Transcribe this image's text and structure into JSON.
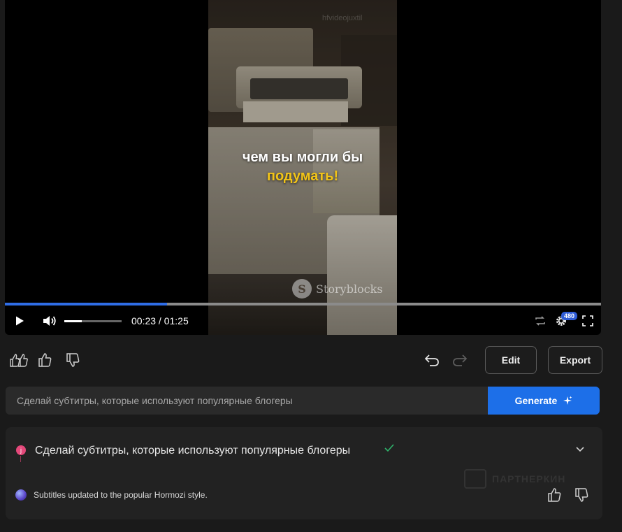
{
  "player": {
    "caption_line1": "чем вы могли бы",
    "caption_line2": "подумать!",
    "top_watermark": "hfvideojuxtil",
    "stock_watermark": "Storyblocks",
    "stock_coin": "S",
    "time_current": "00:23",
    "time_separator": " / ",
    "time_total": "01:25",
    "progress_fraction": 0.272,
    "volume_fraction": 0.3,
    "quality_badge": "480",
    "icons": [
      "play-icon",
      "volume-icon",
      "loop-icon",
      "settings-gear-icon",
      "fullscreen-icon"
    ]
  },
  "actions": {
    "icons": [
      "double-thumbs-up-icon",
      "thumbs-up-icon",
      "thumbs-down-icon",
      "undo-icon",
      "redo-icon"
    ],
    "edit_label": "Edit",
    "export_label": "Export"
  },
  "prompt": {
    "placeholder": "Сделай субтитры, которые используют популярные блогеры",
    "generate_label": "Generate",
    "generate_icon": "sparkle-icon"
  },
  "history": {
    "user_initial": "j",
    "prompt_text": "Сделай субтитры, которые используют популярные блогеры",
    "status_icon": "check-icon",
    "reply_text": "Subtitles updated to the popular Hormozi style.",
    "watermark": "ПАРТНЕРКИН",
    "colors": {
      "user_dot": "#e4487a",
      "check": "#2fb36b",
      "accent": "#1d6fe8"
    }
  }
}
